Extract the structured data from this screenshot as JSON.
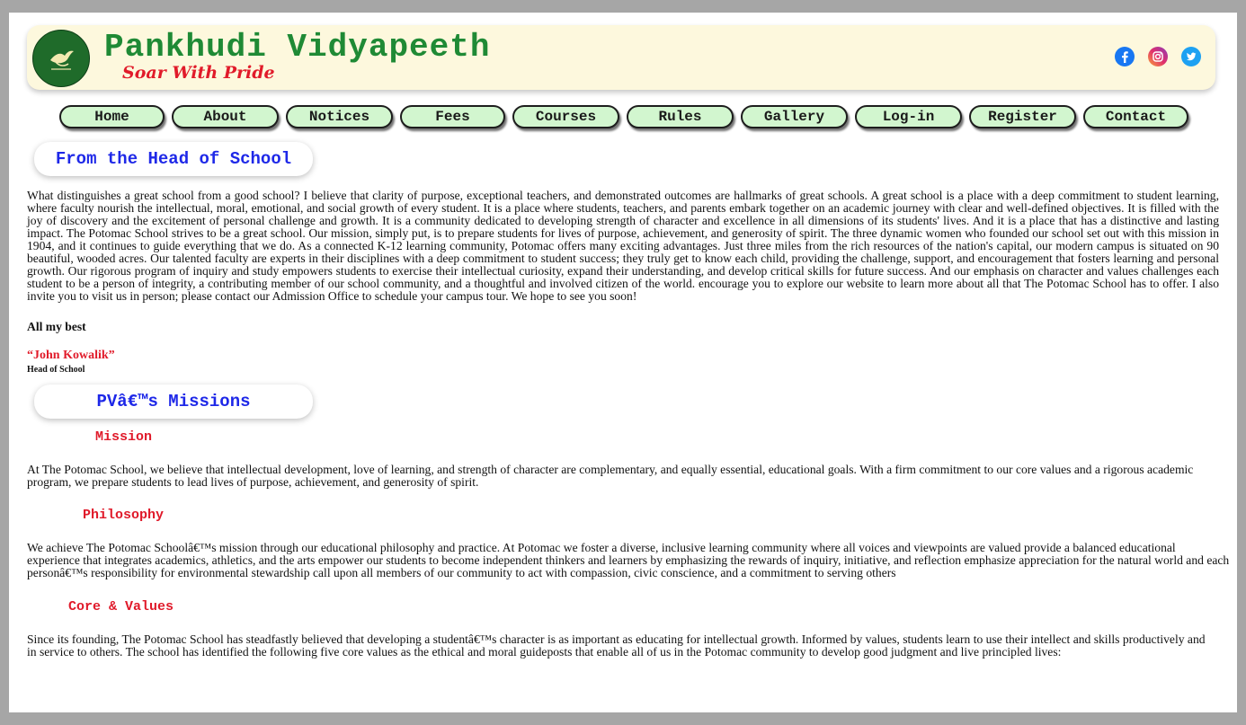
{
  "header": {
    "title": "Pankhudi Vidyapeeth",
    "tagline": "Soar With Pride",
    "social_icons": [
      "facebook-icon",
      "instagram-icon",
      "twitter-icon"
    ]
  },
  "nav": {
    "items": [
      "Home",
      "About",
      "Notices",
      "Fees",
      "Courses",
      "Rules",
      "Gallery",
      "Log-in",
      "Register",
      "Contact"
    ]
  },
  "head_section": {
    "title": "From the Head of School",
    "message": "What distinguishes a great school from a good school? I believe that clarity of purpose, exceptional teachers, and demonstrated outcomes are hallmarks of great schools. A great school is a place with a deep commitment to student learning, where faculty nourish the intellectual, moral, emotional, and social growth of every student. It is a place where students, teachers, and parents embark together on an academic journey with clear and well-defined objectives. It is filled with the joy of discovery and the excitement of personal challenge and growth. It is a community dedicated to developing strength of character and excellence in all dimensions of its students' lives. And it is a place that has a distinctive and lasting impact. The Potomac School strives to be a great school. Our mission, simply put, is to prepare students for lives of purpose, achievement, and generosity of spirit. The three dynamic women who founded our school set out with this mission in 1904, and it continues to guide everything that we do. As a connected K-12 learning community, Potomac offers many exciting advantages. Just three miles from the rich resources of the nation's capital, our modern campus is situated on 90 beautiful, wooded acres. Our talented faculty are experts in their disciplines with a deep commitment to student success; they truly get to know each child, providing the challenge, support, and encouragement that fosters learning and personal growth. Our rigorous program of inquiry and study empowers students to exercise their intellectual curiosity, expand their understanding, and develop critical skills for future success. And our emphasis on character and values challenges each student to be a person of integrity, a contributing member of our school community, and a thoughtful and involved citizen of the world. encourage you to explore our website to learn more about all that The Potomac School has to offer. I also invite you to visit us in person; please contact our Admission Office to schedule your campus tour. We hope to see you soon!",
    "closing": "All my best",
    "signature_name": "“John Kowalik”",
    "signature_role": "Head of School"
  },
  "missions_section": {
    "title": "PVâ€™s Missions",
    "mission_heading": "Mission",
    "mission_text": "At The Potomac School, we believe that intellectual development, love of learning, and strength of character are complementary, and equally essential, educational goals. With a firm commitment to our core values and a rigorous academic program, we prepare students to lead lives of purpose, achievement, and generosity of spirit.",
    "philosophy_heading": "Philosophy",
    "philosophy_text": "We achieve The Potomac Schoolâ€™s mission through our educational philosophy and practice. At Potomac we foster a diverse, inclusive learning community where all voices and viewpoints are valued provide a balanced educational experience that integrates academics, athletics, and the arts empower our students to become independent thinkers and learners by emphasizing the rewards of inquiry, initiative, and reflection emphasize appreciation for the natural world and each personâ€™s responsibility for environmental stewardship call upon all members of our community to act with compassion, civic conscience, and a commitment to serving others",
    "core_heading": "Core & Values",
    "core_text": "Since its founding, The Potomac School has steadfastly believed that developing a studentâ€™s character is as important as educating for intellectual growth. Informed by values, students learn to use their intellect and skills productively and in service to others. The school has identified the following five core values as the ethical and moral guideposts that enable all of us in the Potomac community to develop good judgment and live principled lives:"
  },
  "colors": {
    "page_border": "#a6a6a6",
    "header_bg": "#fdf8dd",
    "title_green": "#1f8a35",
    "tagline_red": "#e11b2a",
    "nav_button_bg": "#d2f6cf",
    "section_title_blue": "#1e28e8",
    "subheading_red": "#e01a2a"
  }
}
